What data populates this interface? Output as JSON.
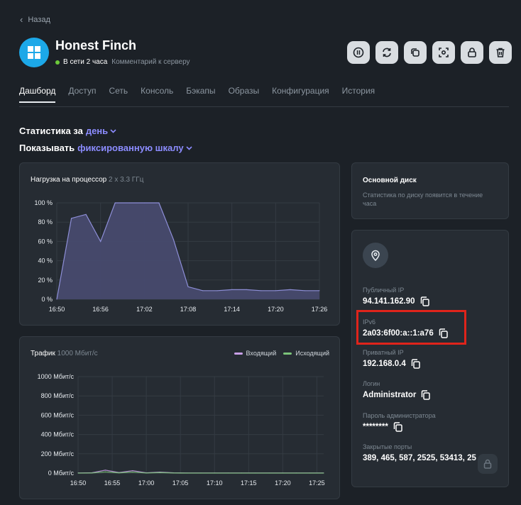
{
  "nav": {
    "back_label": "Назад"
  },
  "server": {
    "name": "Honest Finch",
    "status_text": "В сети 2 часа",
    "comment_link": "Комментарий к серверу",
    "os_icon": "windows-icon",
    "status_color": "#6cc93a"
  },
  "actions": [
    {
      "name": "pause-button",
      "icon": "pause-icon"
    },
    {
      "name": "reboot-button",
      "icon": "refresh-icon"
    },
    {
      "name": "clone-button",
      "icon": "copy-icon"
    },
    {
      "name": "snapshot-button",
      "icon": "screenshot-icon"
    },
    {
      "name": "lock-button",
      "icon": "lock-icon"
    },
    {
      "name": "delete-button",
      "icon": "trash-icon"
    }
  ],
  "tabs": [
    {
      "label": "Дашборд",
      "active": true
    },
    {
      "label": "Доступ"
    },
    {
      "label": "Сеть"
    },
    {
      "label": "Консоль"
    },
    {
      "label": "Бэкапы"
    },
    {
      "label": "Образы"
    },
    {
      "label": "Конфигурация"
    },
    {
      "label": "История"
    }
  ],
  "stats": {
    "period_label": "Статистика за",
    "period_value": "день",
    "scale_label": "Показывать",
    "scale_value": "фиксированную шкалу"
  },
  "cpu_card": {
    "title": "Нагрузка на процессор",
    "subtitle": "2 x 3.3 ГГц"
  },
  "traffic_card": {
    "title": "Трафик",
    "subtitle": "1000 Мбит/с",
    "legend_in": "Входящий",
    "legend_out": "Исходящий"
  },
  "disk_card": {
    "title": "Основной диск",
    "text": "Статистика по диску появится в течение часа"
  },
  "info": {
    "location_icon": "map-pin-icon",
    "public_ip_label": "Публичный IP",
    "public_ip": "94.141.162.90",
    "ipv6_label": "IPv6",
    "ipv6": "2a03:6f00:a::1:a76",
    "private_ip_label": "Приватный IP",
    "private_ip": "192.168.0.4",
    "login_label": "Логин",
    "login": "Administrator",
    "password_label": "Пароль администратора",
    "password": "********",
    "ports_label": "Закрытые порты",
    "ports": "389, 465, 587, 2525, 53413, 25"
  },
  "colors": {
    "accent": "#8c8cff",
    "incoming": "#c9a0e8",
    "outgoing": "#7cc47a",
    "cpu_fill": "#474a6e",
    "cpu_line": "#8e8fd8",
    "highlight": "#e0241b"
  },
  "chart_data": [
    {
      "type": "area",
      "title": "Нагрузка на процессор",
      "subtitle": "2 x 3.3 ГГц",
      "x_ticks": [
        "16:50",
        "16:56",
        "17:02",
        "17:08",
        "17:14",
        "17:20",
        "17:26"
      ],
      "y_ticks": [
        "0 %",
        "20 %",
        "40 %",
        "60 %",
        "80 %",
        "100 %"
      ],
      "ylim": [
        0,
        100
      ],
      "x": [
        "16:50",
        "16:52",
        "16:54",
        "16:56",
        "16:58",
        "17:00",
        "17:02",
        "17:04",
        "17:06",
        "17:08",
        "17:10",
        "17:12",
        "17:14",
        "17:16",
        "17:18",
        "17:20",
        "17:22",
        "17:24",
        "17:26"
      ],
      "series": [
        {
          "values": [
            0,
            84,
            88,
            60,
            100,
            100,
            100,
            100,
            62,
            13,
            9,
            9,
            10,
            10,
            9,
            9,
            10,
            9,
            9
          ]
        }
      ],
      "grid": true
    },
    {
      "type": "line",
      "title": "Трафик",
      "subtitle": "1000 Мбит/с",
      "x_ticks": [
        "16:50",
        "16:55",
        "17:00",
        "17:05",
        "17:10",
        "17:15",
        "17:20",
        "17:25"
      ],
      "y_ticks": [
        "0 Мбит/с",
        "200 Мбит/с",
        "400 Мбит/с",
        "600 Мбит/с",
        "800 Мбит/с",
        "1000 Мбит/с"
      ],
      "ylim": [
        0,
        1000
      ],
      "x": [
        "16:50",
        "16:52",
        "16:54",
        "16:56",
        "16:58",
        "17:00",
        "17:02",
        "17:04",
        "17:06",
        "17:08",
        "17:10",
        "17:12",
        "17:14",
        "17:16",
        "17:18",
        "17:20",
        "17:22",
        "17:24",
        "17:26"
      ],
      "series": [
        {
          "name": "Входящий",
          "values": [
            1,
            2,
            30,
            5,
            25,
            3,
            10,
            2,
            1,
            1,
            1,
            1,
            1,
            1,
            1,
            1,
            1,
            1,
            1
          ]
        },
        {
          "name": "Исходящий",
          "values": [
            0,
            1,
            12,
            2,
            10,
            1,
            5,
            1,
            0,
            0,
            0,
            0,
            0,
            0,
            0,
            0,
            0,
            0,
            0
          ]
        }
      ],
      "legend": "top-right",
      "grid": true
    }
  ]
}
